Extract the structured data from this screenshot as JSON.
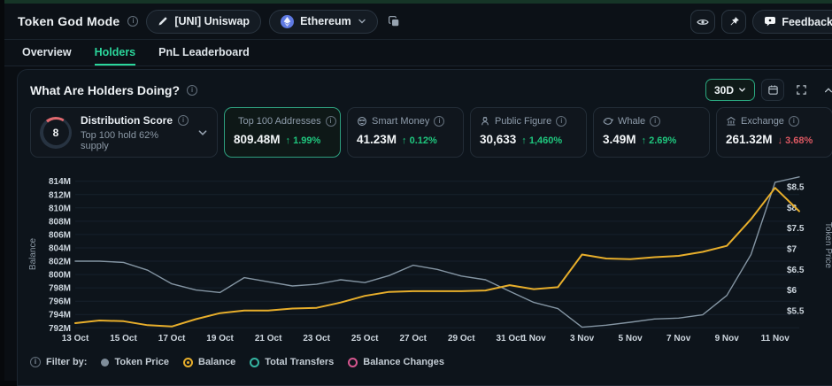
{
  "header": {
    "title": "Token God Mode",
    "token_button_label": "[UNI] Uniswap",
    "chain_button_label": "Ethereum",
    "feedback_button_label": "Feedback"
  },
  "tabs": {
    "overview": "Overview",
    "holders": "Holders",
    "pnl": "PnL Leaderboard"
  },
  "panel": {
    "title": "What Are Holders Doing?",
    "range_selector": "30D",
    "filter_label": "Filter by:"
  },
  "cards": [
    {
      "label": "Distribution Score",
      "score": "8",
      "subtitle": "Top 100 hold 62% supply"
    },
    {
      "label": "Top 100 Addresses",
      "value": "809.48M",
      "change": "↑ 1.99%",
      "direction": "up",
      "selected": true,
      "icon": "id-card-icon"
    },
    {
      "label": "Smart Money",
      "value": "41.23M",
      "change": "↑ 0.12%",
      "direction": "up",
      "icon": "smart-money-icon"
    },
    {
      "label": "Public Figure",
      "value": "30,633",
      "change": "↑ 1,460%",
      "direction": "up",
      "icon": "public-figure-icon"
    },
    {
      "label": "Whale",
      "value": "3.49M",
      "change": "↑ 2.69%",
      "direction": "up",
      "icon": "whale-icon"
    },
    {
      "label": "Exchange",
      "value": "261.32M",
      "change": "↓ 3.68%",
      "direction": "down",
      "icon": "bank-icon"
    }
  ],
  "legend": [
    {
      "label": "Token Price",
      "color": "#7f8d9a",
      "style": "filled"
    },
    {
      "label": "Balance",
      "color": "#e7ae2b",
      "style": "radio"
    },
    {
      "label": "Total Transfers",
      "color": "#35b5a2",
      "style": "ring"
    },
    {
      "label": "Balance Changes",
      "color": "#d6568f",
      "style": "ring"
    }
  ],
  "colors": {
    "accent_green": "#2bd69b",
    "up_green": "#1fc77e",
    "down_red": "#dd5862",
    "balance_line": "#e7ae2b",
    "price_line": "#8495a3",
    "score_arc": "#e0696f"
  },
  "chart_data": {
    "type": "line",
    "title": "What Are Holders Doing?",
    "x": [
      "13 Oct",
      "14 Oct",
      "15 Oct",
      "16 Oct",
      "17 Oct",
      "18 Oct",
      "19 Oct",
      "20 Oct",
      "21 Oct",
      "22 Oct",
      "23 Oct",
      "24 Oct",
      "25 Oct",
      "26 Oct",
      "27 Oct",
      "28 Oct",
      "29 Oct",
      "30 Oct",
      "31 Oct",
      "1 Nov",
      "2 Nov",
      "3 Nov",
      "4 Nov",
      "5 Nov",
      "6 Nov",
      "7 Nov",
      "8 Nov",
      "9 Nov",
      "10 Nov",
      "11 Nov",
      "12 Nov"
    ],
    "x_tick_indices": [
      0,
      2,
      4,
      6,
      8,
      10,
      12,
      14,
      16,
      18,
      19,
      21,
      23,
      25,
      27,
      29
    ],
    "series": [
      {
        "name": "Token Price",
        "axis": "right",
        "color": "#8495a3",
        "width": 1.4,
        "values": [
          6.7,
          6.7,
          6.67,
          6.48,
          6.15,
          6.0,
          5.94,
          6.3,
          6.2,
          6.1,
          6.14,
          6.25,
          6.18,
          6.35,
          6.6,
          6.5,
          6.34,
          6.25,
          5.97,
          5.7,
          5.55,
          5.1,
          5.15,
          5.22,
          5.3,
          5.32,
          5.4,
          5.87,
          6.86,
          8.61,
          8.74
        ]
      },
      {
        "name": "Balance",
        "axis": "left",
        "color": "#e7ae2b",
        "width": 2,
        "values": [
          792.7,
          793.1,
          793.0,
          792.4,
          792.2,
          793.3,
          794.2,
          794.6,
          794.6,
          794.9,
          795.0,
          795.8,
          796.8,
          797.4,
          797.5,
          797.5,
          797.5,
          797.6,
          798.4,
          797.8,
          798.1,
          803.0,
          802.4,
          802.3,
          802.6,
          802.8,
          803.4,
          804.3,
          808.3,
          813.0,
          809.5
        ]
      }
    ],
    "left_axis": {
      "label": "Balance",
      "unit": "M",
      "ticks": [
        "814M",
        "812M",
        "810M",
        "808M",
        "806M",
        "804M",
        "802M",
        "800M",
        "798M",
        "796M",
        "794M",
        "792M"
      ],
      "tick_values": [
        814,
        812,
        810,
        808,
        806,
        804,
        802,
        800,
        798,
        796,
        794,
        792
      ],
      "min": 792,
      "max": 814
    },
    "right_axis": {
      "label": "Token Price",
      "ticks": [
        "$8.5",
        "$8",
        "$7.5",
        "$7",
        "$6.5",
        "$6",
        "$5.5"
      ],
      "tick_values": [
        8.5,
        8.0,
        7.5,
        7.0,
        6.5,
        6.0,
        5.5
      ],
      "min": 5.085,
      "max": 8.635
    },
    "grid": true,
    "legend_position": "bottom"
  }
}
